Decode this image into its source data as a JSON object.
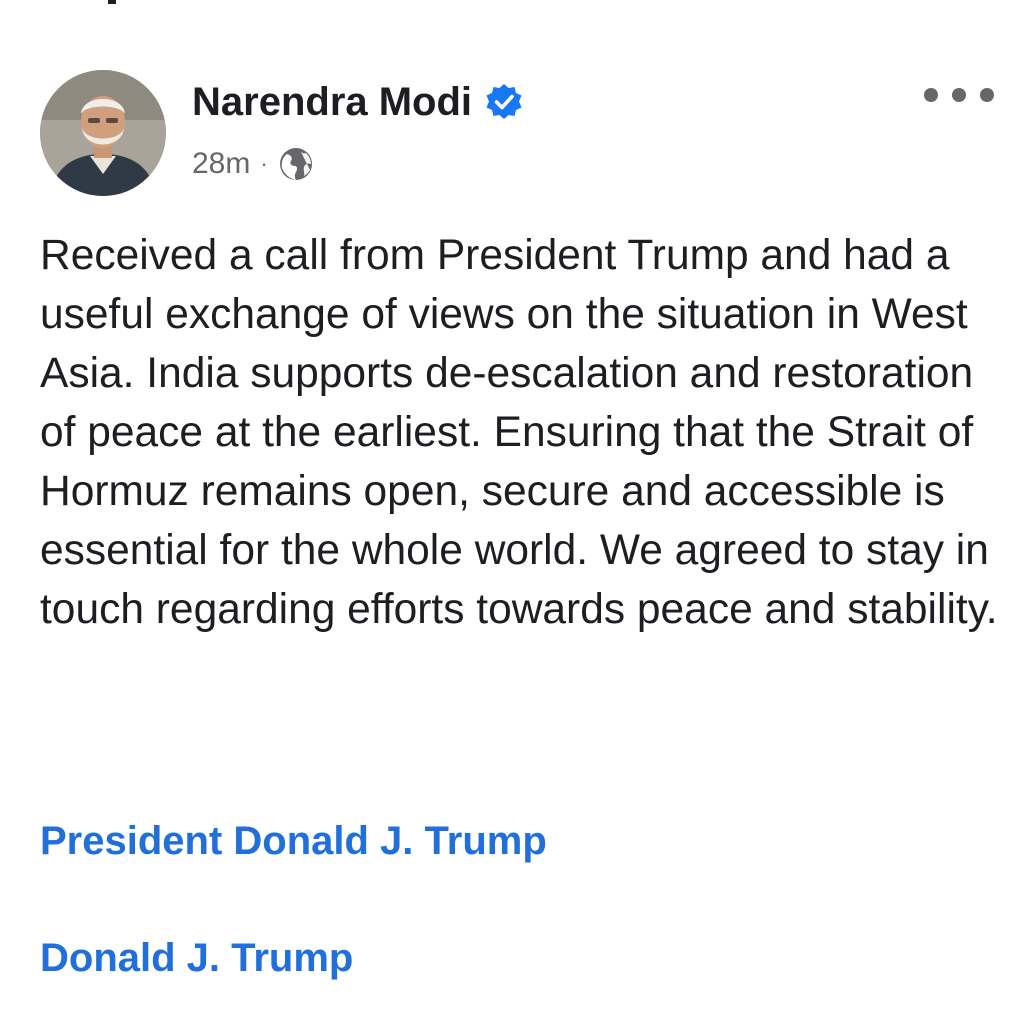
{
  "post": {
    "author": {
      "name": "Narendra Modi",
      "verified": true,
      "avatar": "profile-photo"
    },
    "time": "28m",
    "separator": "·",
    "privacy_icon": "globe-icon",
    "more_icon": "more-options-icon",
    "text": "Received a call from President Trump and had a useful exchange of views on the situation in West Asia. India supports de-escalation and restoration of peace at the earliest. Ensuring that the Strait of Hormuz remains open, secure and accessible is essential for the whole world. We agreed to stay in touch regarding efforts towards peace and stability.",
    "tags": [
      {
        "label": "President Donald J. Trump"
      },
      {
        "label": "Donald J. Trump"
      }
    ]
  },
  "colors": {
    "text": "#1c1e21",
    "secondary": "#65676b",
    "link": "#216fdb",
    "verified": "#1877f2"
  }
}
